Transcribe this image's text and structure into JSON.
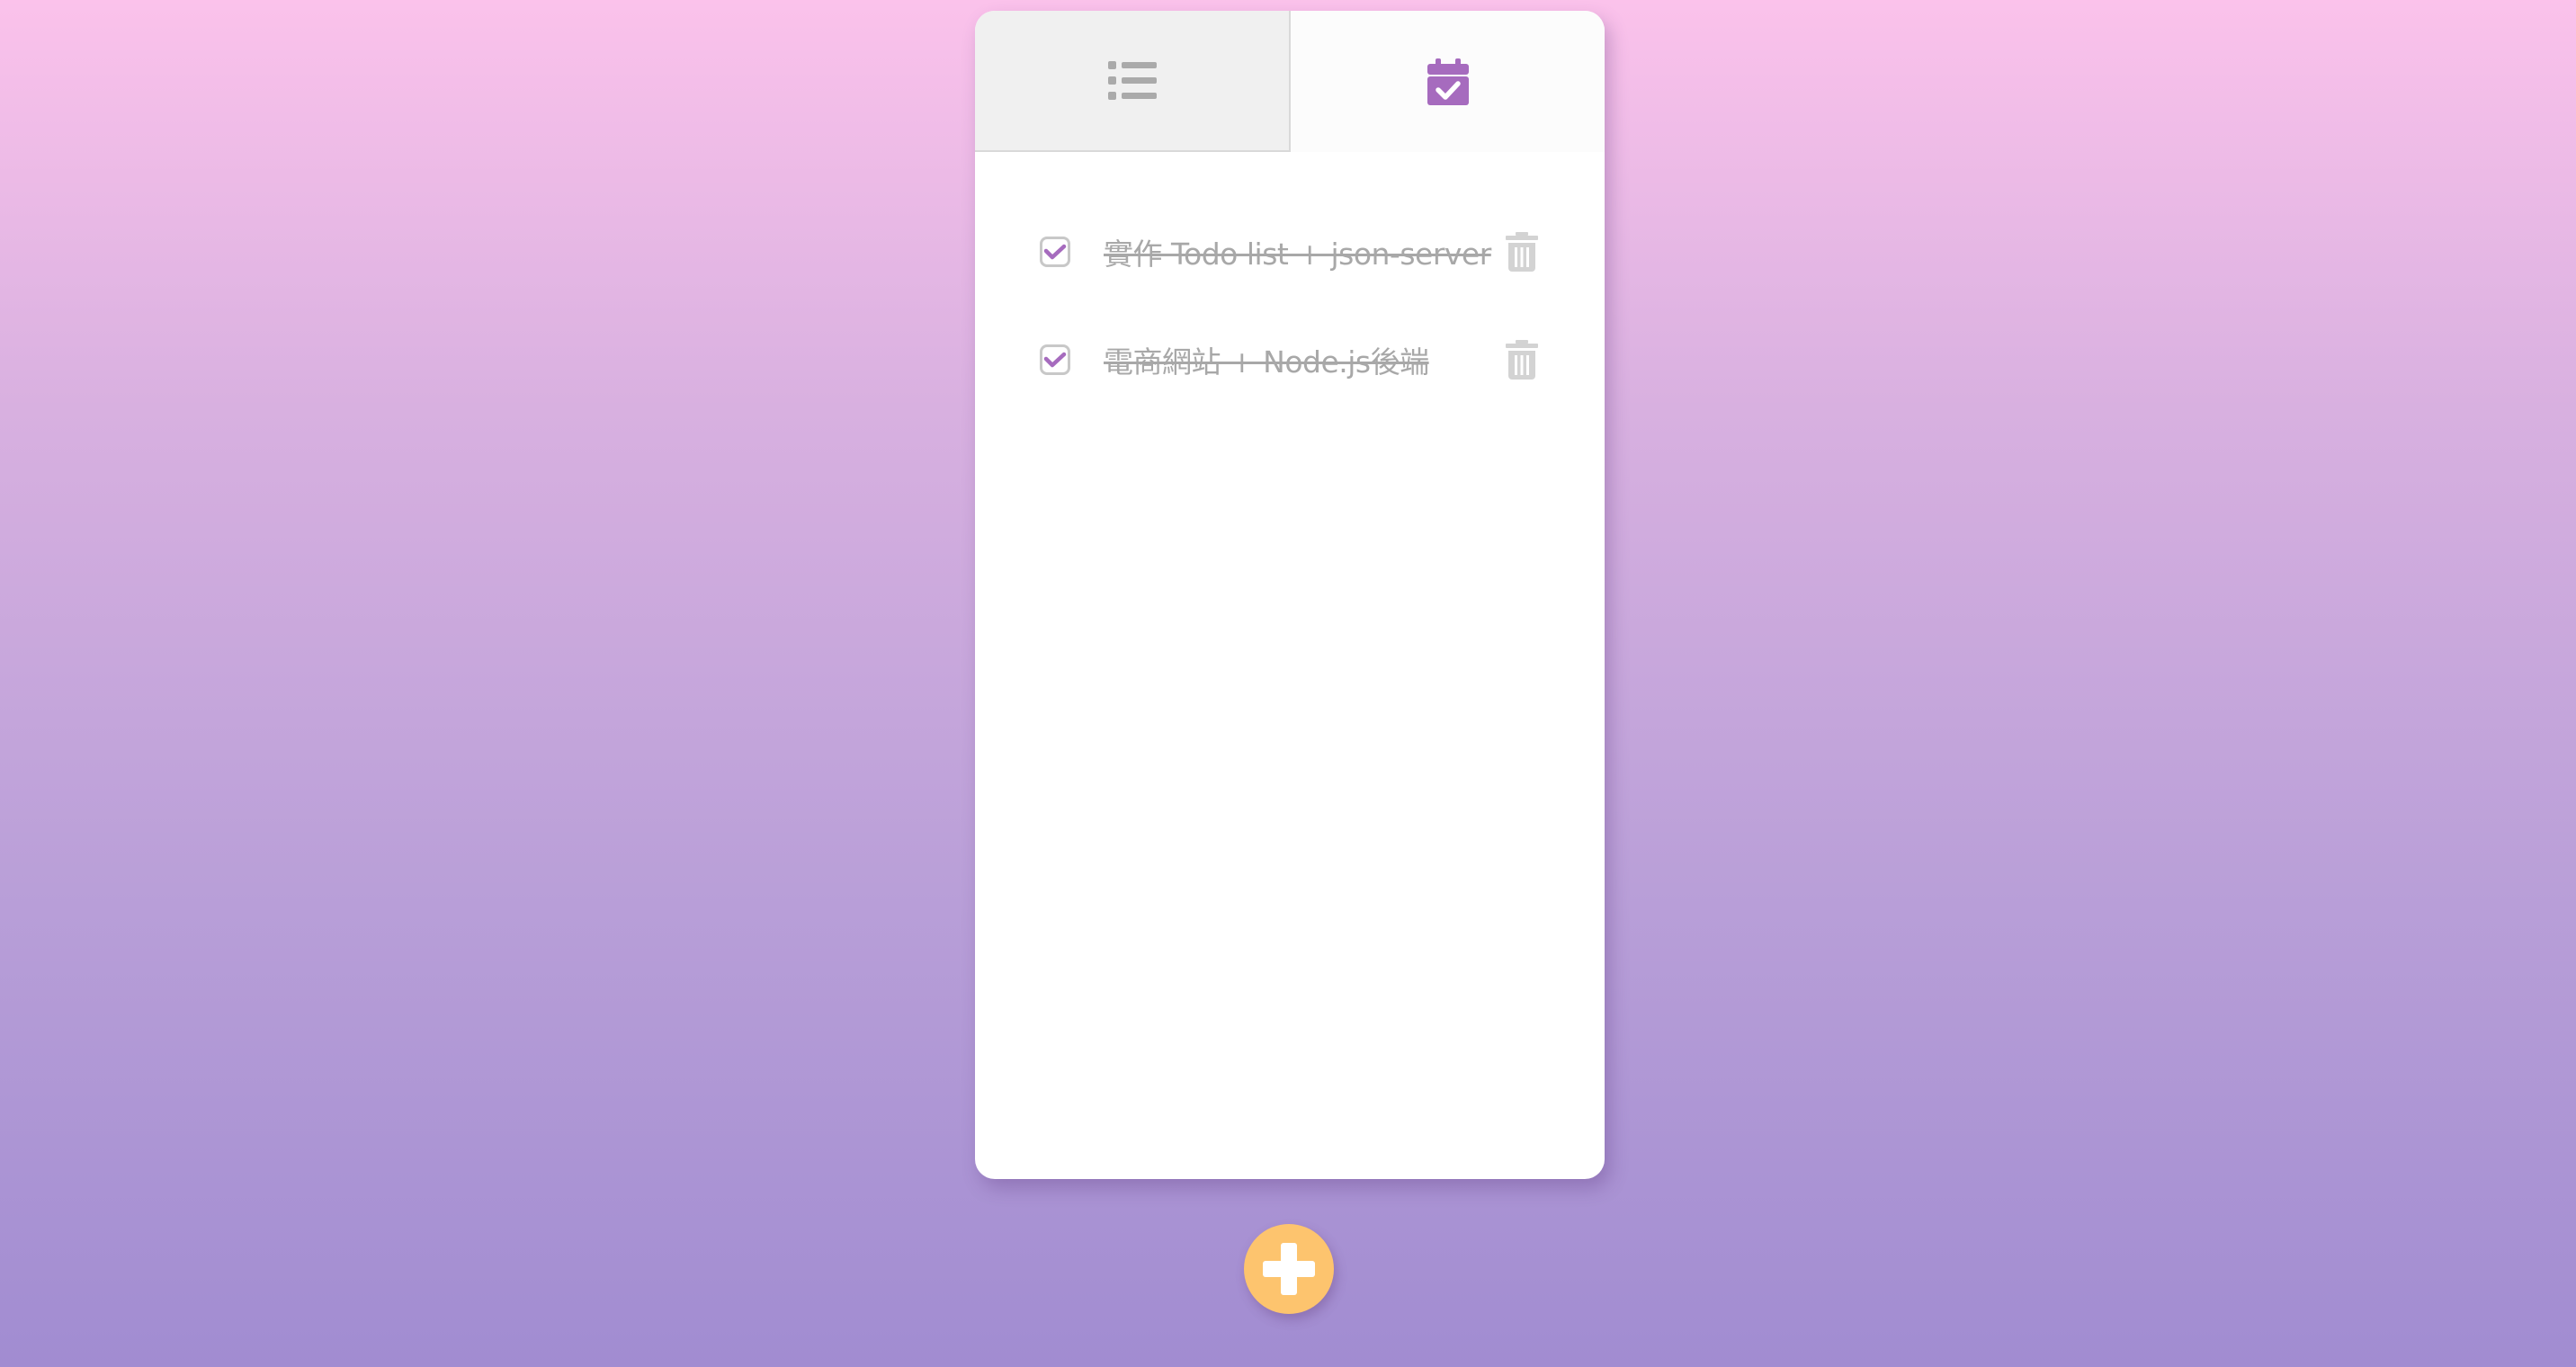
{
  "tabs": [
    {
      "name": "all",
      "icon": "list-icon",
      "active": false
    },
    {
      "name": "completed",
      "icon": "calendar-check-icon",
      "active": true
    }
  ],
  "todos": [
    {
      "text": "實作 Todo list + json-server",
      "completed": true
    },
    {
      "text": "電商網站 + Node.js後端",
      "completed": true
    }
  ],
  "add_button": {
    "icon": "plus-icon"
  },
  "colors": {
    "accent": "#a66bbe",
    "fab": "#fdc46e",
    "muted_text": "#a8a8a8",
    "inactive_icon": "#aaaaaa",
    "trash_icon": "#d3d3d3"
  }
}
